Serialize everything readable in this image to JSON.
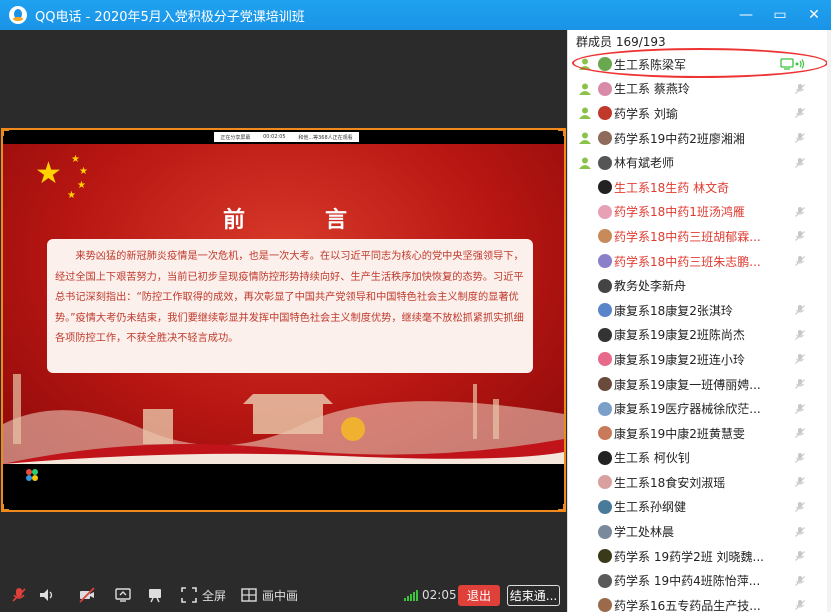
{
  "window": {
    "title": "QQ电话 - 2020年5月入党积极分子党课培训班",
    "controls": [
      "—",
      "▭",
      "✕"
    ]
  },
  "share_bar": {
    "status": "正在分享屏幕",
    "time": "00:02:05",
    "viewers": "和他...等368人正在观看"
  },
  "slide": {
    "title": "前言",
    "body": "来势凶猛的新冠肺炎疫情是一次危机，也是一次大考。在以习近平同志为核心的党中央坚强领导下，经过全国上下艰苦努力，当前已初步呈现疫情防控形势持续向好、生产生活秩序加快恢复的态势。习近平总书记深刻指出：“防控工作取得的成效，再次彰显了中国共产党领导和中国特色社会主义制度的显著优势。”疫情大考仍未结束，我们要继续彰显并发挥中国特色社会主义制度优势，继续毫不放松抓紧抓实抓细各项防控工作，不获全胜决不轻言成功。"
  },
  "toolbar": {
    "fullscreen_label": "全屏",
    "pip_label": "画中画",
    "timer": "02:05",
    "exit_label": "退出",
    "end_label": "结束通..."
  },
  "panel": {
    "header": "群成员 169/193",
    "members": [
      {
        "name": "生工系陈梁军",
        "admin": true,
        "red": false,
        "mic": "speaking",
        "avatar": "#6aa84f"
      },
      {
        "name": "生工系 蔡燕玲",
        "admin": true,
        "red": false,
        "mic": "muted",
        "avatar": "#d98aa8"
      },
      {
        "name": "药学系 刘瑜",
        "admin": true,
        "red": false,
        "mic": "muted",
        "avatar": "#c0392b"
      },
      {
        "name": "药学系19中药2班廖湘湘",
        "admin": true,
        "red": false,
        "mic": "muted",
        "avatar": "#8e6b5a"
      },
      {
        "name": "林有斌老师",
        "admin": true,
        "red": false,
        "mic": "muted",
        "avatar": "#555555"
      },
      {
        "name": "生工系18生药 林文奇",
        "admin": false,
        "red": true,
        "mic": "none",
        "avatar": "#222222"
      },
      {
        "name": "药学系18中药1班汤鸿雁",
        "admin": false,
        "red": true,
        "mic": "muted",
        "avatar": "#e8a0b4"
      },
      {
        "name": "药学系18中药三班胡郁霖...",
        "admin": false,
        "red": true,
        "mic": "muted",
        "avatar": "#c98a5a"
      },
      {
        "name": "药学系18中药三班朱志鹏...",
        "admin": false,
        "red": true,
        "mic": "muted",
        "avatar": "#8a7fc9"
      },
      {
        "name": "教务处李新舟",
        "admin": false,
        "red": false,
        "mic": "none",
        "avatar": "#444444"
      },
      {
        "name": "康复系18康复2张淇玲",
        "admin": false,
        "red": false,
        "mic": "muted",
        "avatar": "#5a86c9"
      },
      {
        "name": "康复系19康复2班陈尚杰",
        "admin": false,
        "red": false,
        "mic": "muted",
        "avatar": "#333333"
      },
      {
        "name": "康复系19康复2班连小玲",
        "admin": false,
        "red": false,
        "mic": "muted",
        "avatar": "#e86a8a"
      },
      {
        "name": "康复系19康复一班傅丽娉...",
        "admin": false,
        "red": false,
        "mic": "muted",
        "avatar": "#6a4a3a"
      },
      {
        "name": "康复系19医疗器械徐欣茫...",
        "admin": false,
        "red": false,
        "mic": "muted",
        "avatar": "#7aa0c9"
      },
      {
        "name": "康复系19中康2班黄慧雯",
        "admin": false,
        "red": false,
        "mic": "muted",
        "avatar": "#c97a5a"
      },
      {
        "name": "生工系 柯伙钊",
        "admin": false,
        "red": false,
        "mic": "muted",
        "avatar": "#222222"
      },
      {
        "name": "生工系18食安刘淑瑶",
        "admin": false,
        "red": false,
        "mic": "muted",
        "avatar": "#d9a0a0"
      },
      {
        "name": "生工系孙纲健",
        "admin": false,
        "red": false,
        "mic": "muted",
        "avatar": "#4a7a9a"
      },
      {
        "name": "学工处林晨",
        "admin": false,
        "red": false,
        "mic": "muted",
        "avatar": "#7a8a9a"
      },
      {
        "name": "药学系 19药学2班 刘晓魏...",
        "admin": false,
        "red": false,
        "mic": "muted",
        "avatar": "#3a3a1a"
      },
      {
        "name": "药学系 19中药4班陈怡萍...",
        "admin": false,
        "red": false,
        "mic": "muted",
        "avatar": "#5a5a5a"
      },
      {
        "name": "药学系16五专药品生产技...",
        "admin": false,
        "red": false,
        "mic": "muted",
        "avatar": "#9a6a4a"
      }
    ]
  },
  "colors": {
    "titlebar": "#1a93e6",
    "highlight": "#e33333",
    "exit": "#e0403a",
    "active_mic": "#3cc43c"
  }
}
